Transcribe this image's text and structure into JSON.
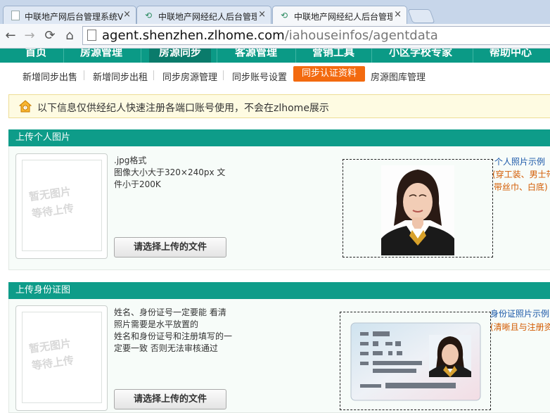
{
  "browser": {
    "tabs": [
      {
        "title": "中联地产网后台管理系统V"
      },
      {
        "title": "中联地产网经纪人后台管理"
      },
      {
        "title": "中联地产网经纪人后台管理"
      }
    ],
    "url_host": "agent.shenzhen.zlhome.com",
    "url_path": "/iahouseinfos/agentdata"
  },
  "main_nav": {
    "items": [
      {
        "label": "首页"
      },
      {
        "label": "房源管理"
      },
      {
        "label": "房源同步"
      },
      {
        "label": "客源管理"
      },
      {
        "label": "营销工具"
      },
      {
        "label": "小区学校专家"
      },
      {
        "label": "帮助中心"
      }
    ],
    "active_index": 2
  },
  "sub_nav": {
    "items": [
      {
        "label": "新增同步出售"
      },
      {
        "label": "新增同步出租"
      },
      {
        "label": "同步房源管理"
      },
      {
        "label": "同步账号设置"
      },
      {
        "label": "同步认证资料"
      },
      {
        "label": "房源图库管理"
      }
    ],
    "active_index": 4
  },
  "notice": {
    "text": "以下信息仅供经纪人快速注册各端口账号使用，不会在zlhome展示"
  },
  "photo_section": {
    "title": "上传个人图片",
    "placeholder_line1": "暂无图片",
    "placeholder_line2": "等待上传",
    "desc_lines": [
      ".jpg格式",
      "图像大小大于320×240px 文",
      "件小于200K"
    ],
    "button": "请选择上传的文件",
    "sample_link": "个人照片示例",
    "sample_note_line1": "(穿工装、男士带",
    "sample_note_line2": "带丝巾、白底)"
  },
  "id_section": {
    "title": "上传身份证图",
    "placeholder_line1": "暂无图片",
    "placeholder_line2": "等待上传",
    "desc_lines": [
      "姓名、身份证号一定要能 看清",
      "照片需要是水平放置的",
      "姓名和身份证号和注册填写的一",
      "定要一致 否则无法审核通过"
    ],
    "button": "请选择上传的文件",
    "sample_link": "身份证照片示例",
    "sample_note": "(清晰且与注册资"
  },
  "colors": {
    "brand_green": "#0b9a86",
    "active_orange": "#f36a0f",
    "notice_bg": "#fefbe2",
    "link_blue": "#1a57a8",
    "note_orange": "#d35a00"
  }
}
